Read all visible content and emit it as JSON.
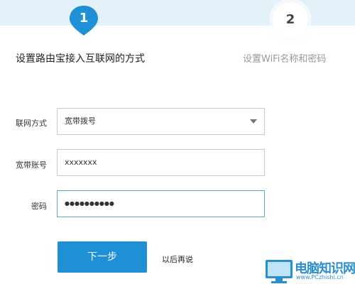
{
  "steps": [
    {
      "number": "1",
      "label": "设置路由宝接入互联网的方式"
    },
    {
      "number": "2",
      "label": "设置WiFi名称和密码"
    }
  ],
  "form": {
    "connection_type": {
      "label": "联网方式",
      "value": "宽带拨号"
    },
    "account": {
      "label": "宽带账号",
      "value": "xxxxxxx"
    },
    "password": {
      "label": "密码",
      "value": "●●●●●●●●●●"
    }
  },
  "actions": {
    "next_label": "下一步",
    "later_label": "以后再说"
  },
  "watermark": {
    "text": "电脑知识网",
    "url": "www.PCzhishi.cn"
  },
  "colors": {
    "accent": "#1f8fd6",
    "top_band": "#e3f1f8",
    "focus_border": "#5aa6d6"
  }
}
